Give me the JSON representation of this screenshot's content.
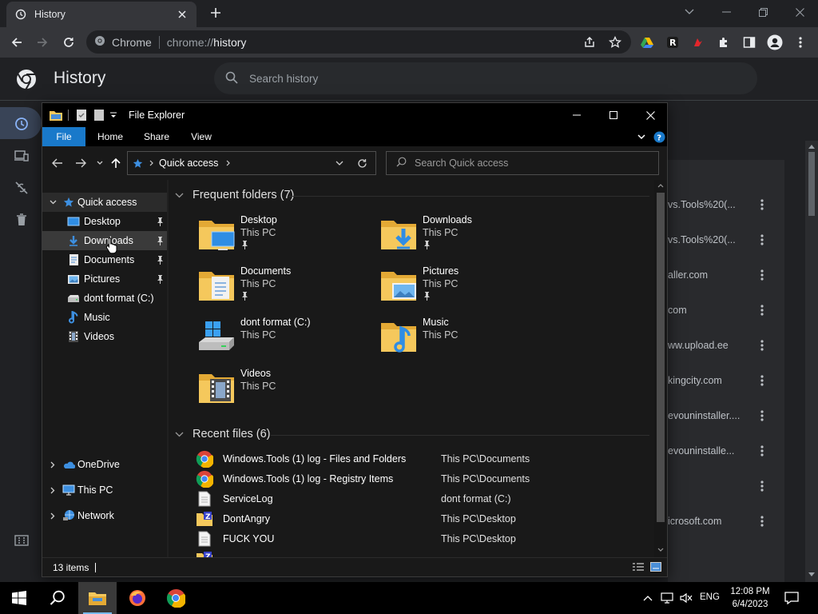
{
  "chrome": {
    "tab_title": "History",
    "omnibox_site": "Chrome",
    "omnibox_url_prefix": "chrome://",
    "omnibox_url_path": "history"
  },
  "history": {
    "title": "History",
    "search_placeholder": "Search history",
    "rows": [
      {
        "text": "vs.Tools%20(..."
      },
      {
        "text": "vs.Tools%20(..."
      },
      {
        "text": "aller.com"
      },
      {
        "text": "com"
      },
      {
        "text": "ww.upload.ee"
      },
      {
        "text": "kingcity.com"
      },
      {
        "text": "evouninstaller...."
      },
      {
        "text": "evouninstalle..."
      },
      {
        "text": ""
      },
      {
        "text": "icrosoft.com"
      }
    ]
  },
  "explorer": {
    "window_title": "File Explorer",
    "ribbon_tabs": [
      "File",
      "Home",
      "Share",
      "View"
    ],
    "address_crumb": "Quick access",
    "search_placeholder": "Search Quick access",
    "nav": {
      "quick_access": "Quick access",
      "pinned": [
        {
          "label": "Desktop",
          "icon": "desktop-icon",
          "pinned": true
        },
        {
          "label": "Downloads",
          "icon": "downloads-icon",
          "pinned": true
        },
        {
          "label": "Documents",
          "icon": "documents-icon",
          "pinned": true
        },
        {
          "label": "Pictures",
          "icon": "pictures-icon",
          "pinned": true
        },
        {
          "label": "dont format (C:)",
          "icon": "drive-icon",
          "pinned": false
        },
        {
          "label": "Music",
          "icon": "music-icon",
          "pinned": false
        },
        {
          "label": "Videos",
          "icon": "videos-icon",
          "pinned": false
        }
      ],
      "onedrive": "OneDrive",
      "this_pc": "This PC",
      "network": "Network"
    },
    "frequent": {
      "header": "Frequent folders (7)",
      "items": [
        {
          "name": "Desktop",
          "loc": "This PC",
          "pinned": true
        },
        {
          "name": "Downloads",
          "loc": "This PC",
          "pinned": true
        },
        {
          "name": "Documents",
          "loc": "This PC",
          "pinned": true
        },
        {
          "name": "Pictures",
          "loc": "This PC",
          "pinned": true
        },
        {
          "name": "dont format (C:)",
          "loc": "This PC",
          "pinned": false
        },
        {
          "name": "Music",
          "loc": "This PC",
          "pinned": false
        },
        {
          "name": "Videos",
          "loc": "This PC",
          "pinned": false
        }
      ]
    },
    "recent": {
      "header": "Recent files (6)",
      "items": [
        {
          "name": "Windows.Tools (1) log - Files and Folders",
          "loc": "This PC\\Documents",
          "icon": "chrome-file-icon"
        },
        {
          "name": "Windows.Tools (1) log - Registry Items",
          "loc": "This PC\\Documents",
          "icon": "chrome-file-icon"
        },
        {
          "name": "ServiceLog",
          "loc": "dont format (C:)",
          "icon": "text-file-icon"
        },
        {
          "name": "DontAngry",
          "loc": "This PC\\Desktop",
          "icon": "zip-folder-icon"
        },
        {
          "name": "FUCK YOU",
          "loc": "This PC\\Desktop",
          "icon": "text-file-icon"
        }
      ]
    },
    "status": "13 items"
  },
  "taskbar": {
    "lang": "ENG",
    "time": "12:08 PM",
    "date": "6/4/2023"
  },
  "colors": {
    "accent": "#1979ca",
    "chrome_dark": "#202124",
    "folder": "#f5c85c"
  }
}
